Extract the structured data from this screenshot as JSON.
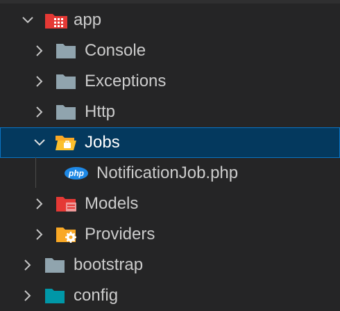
{
  "explorer": {
    "items": [
      {
        "label": "app",
        "expanded": true,
        "icon": "folder-app-icon"
      },
      {
        "label": "Console",
        "expanded": false,
        "icon": "folder-icon"
      },
      {
        "label": "Exceptions",
        "expanded": false,
        "icon": "folder-icon"
      },
      {
        "label": "Http",
        "expanded": false,
        "icon": "folder-icon"
      },
      {
        "label": "Jobs",
        "expanded": true,
        "selected": true,
        "icon": "folder-jobs-open-icon"
      },
      {
        "label": "NotificationJob.php",
        "icon": "php-file-icon",
        "icon_text": "php"
      },
      {
        "label": "Models",
        "expanded": false,
        "icon": "folder-models-icon"
      },
      {
        "label": "Providers",
        "expanded": false,
        "icon": "folder-providers-icon"
      },
      {
        "label": "bootstrap",
        "expanded": false,
        "icon": "folder-icon"
      },
      {
        "label": "config",
        "expanded": false,
        "icon": "folder-config-icon"
      }
    ]
  },
  "colors": {
    "background": "#252526",
    "selection": "#04395e",
    "selection_border": "#0a74c4",
    "folder_default": "#90a4ae",
    "folder_app": "#e53935",
    "folder_jobs": "#f9a825",
    "php_icon": "#1e88e5"
  }
}
